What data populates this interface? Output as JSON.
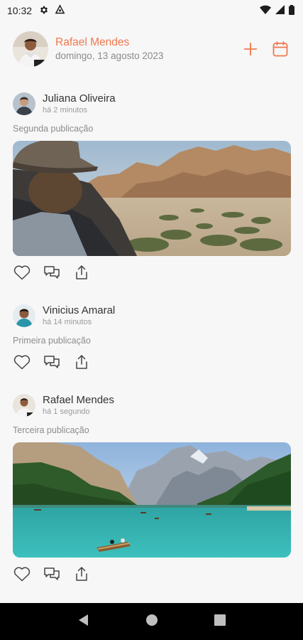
{
  "status_bar": {
    "time": "10:32",
    "icons": [
      "gear-icon",
      "data-saver-icon",
      "wifi-icon",
      "signal-icon",
      "battery-icon"
    ]
  },
  "header": {
    "user_name": "Rafael Mendes",
    "date": "domingo, 13 agosto 2023",
    "actions": [
      "plus-icon",
      "calendar-icon"
    ],
    "accent_color": "#f0784e"
  },
  "posts": [
    {
      "author": "Juliana Oliveira",
      "time_ago": "há 2 minutos",
      "text": "Segunda publicação",
      "has_image": true,
      "image_subject": "desert-mountains"
    },
    {
      "author": "Vinicius Amaral",
      "time_ago": "há 14 minutos",
      "text": "Primeira publicação",
      "has_image": false
    },
    {
      "author": "Rafael Mendes",
      "time_ago": "há 1 segundo",
      "text": "Terceira publicação",
      "has_image": true,
      "image_subject": "mountain-lake"
    }
  ],
  "post_actions": [
    "heart-icon",
    "comments-icon",
    "share-icon"
  ],
  "nav_bar": [
    "back-icon",
    "home-icon",
    "recents-icon"
  ]
}
